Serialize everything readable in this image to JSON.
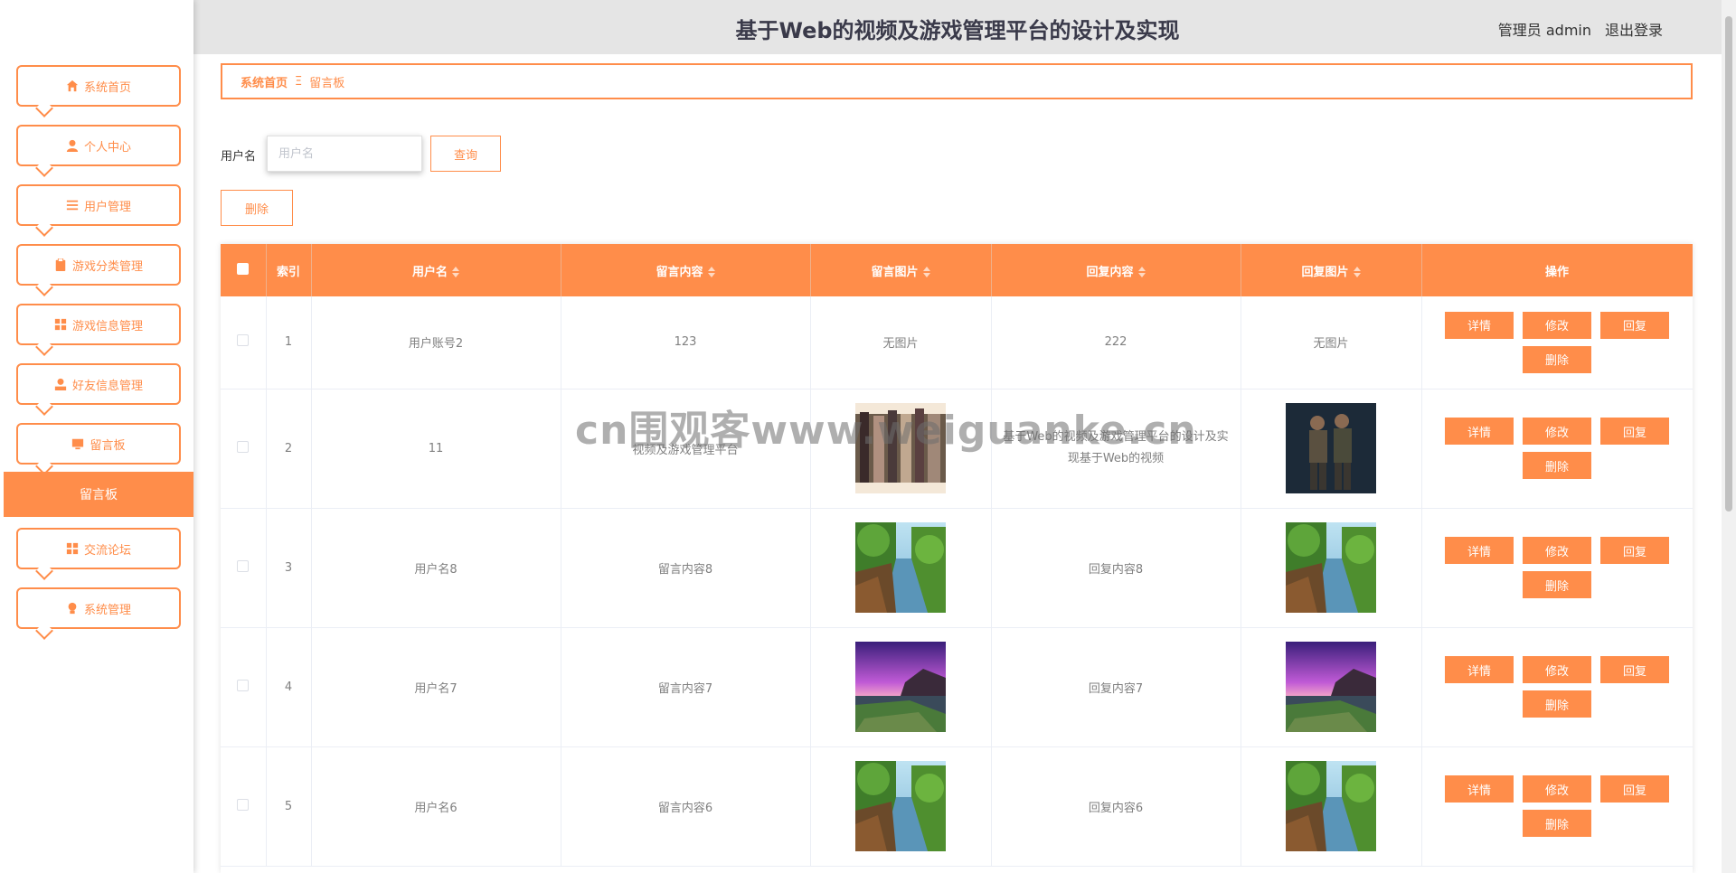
{
  "header": {
    "title": "基于Web的视频及游戏管理平台的设计及实现",
    "user_label": "管理员 admin",
    "logout": "退出登录"
  },
  "sidebar": {
    "items": [
      {
        "label": "系统首页",
        "icon": "home-icon"
      },
      {
        "label": "个人中心",
        "icon": "user-icon"
      },
      {
        "label": "用户管理",
        "icon": "list-icon"
      },
      {
        "label": "游戏分类管理",
        "icon": "clipboard-icon"
      },
      {
        "label": "游戏信息管理",
        "icon": "grid-icon"
      },
      {
        "label": "好友信息管理",
        "icon": "person-icon"
      },
      {
        "label": "留言板",
        "icon": "monitor-icon"
      }
    ],
    "active_item": "留言板",
    "items_after": [
      {
        "label": "交流论坛",
        "icon": "grid-icon"
      },
      {
        "label": "系统管理",
        "icon": "bulb-icon"
      }
    ]
  },
  "breadcrumb": {
    "home": "系统首页",
    "separator": "Ξ",
    "current": "留言板"
  },
  "search": {
    "label": "用户名",
    "placeholder": "用户名",
    "query_button": "查询",
    "delete_button": "删除"
  },
  "table": {
    "columns": [
      "索引",
      "用户名",
      "留言内容",
      "留言图片",
      "回复内容",
      "回复图片",
      "操作"
    ],
    "rows": [
      {
        "index": "1",
        "username": "用户账号2",
        "message": "123",
        "message_image": "无图片",
        "reply": "222",
        "reply_image": "无图片"
      },
      {
        "index": "2",
        "username": "11",
        "message": "视频及游戏管理平台",
        "message_image": "crowd-photo",
        "reply": "基于Web的视频及游戏管理平台的设计及实现基于Web的视频",
        "reply_image": "soldiers-photo"
      },
      {
        "index": "3",
        "username": "用户名8",
        "message": "留言内容8",
        "message_image": "river-forest-photo",
        "reply": "回复内容8",
        "reply_image": "river-forest-photo"
      },
      {
        "index": "4",
        "username": "用户名7",
        "message": "留言内容7",
        "message_image": "purple-sunset-photo",
        "reply": "回复内容7",
        "reply_image": "purple-sunset-photo"
      },
      {
        "index": "5",
        "username": "用户名6",
        "message": "留言内容6",
        "message_image": "river-forest-photo",
        "reply": "回复内容6",
        "reply_image": "river-forest-photo"
      }
    ],
    "actions": {
      "detail": "详情",
      "edit": "修改",
      "reply": "回复",
      "delete": "删除"
    }
  },
  "watermark": "cn围观客www.weiguanke.cn",
  "colors": {
    "accent": "#FF8D4A",
    "header_bg": "#e5e5e5"
  }
}
